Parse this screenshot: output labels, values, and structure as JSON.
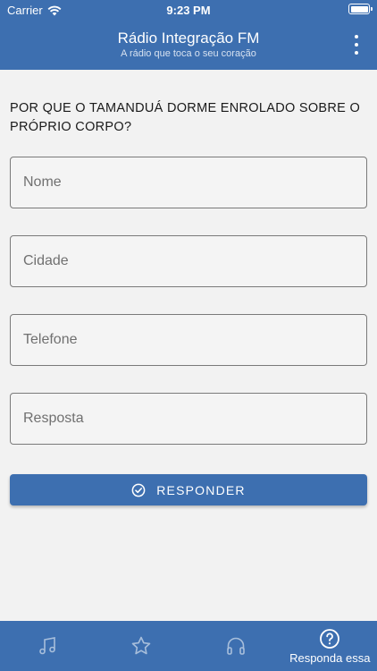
{
  "status_bar": {
    "carrier": "Carrier",
    "time": "9:23 PM"
  },
  "app_bar": {
    "title": "Rádio Integração FM",
    "subtitle": "A rádio que toca o seu coração"
  },
  "question": "POR QUE O TAMANDUÁ DORME ENROLADO SOBRE O PRÓPRIO CORPO?",
  "form": {
    "name_placeholder": "Nome",
    "city_placeholder": "Cidade",
    "phone_placeholder": "Telefone",
    "answer_placeholder": "Resposta",
    "submit_label": "RESPONDER"
  },
  "tabs": [
    {
      "icon": "music-note-icon",
      "label": ""
    },
    {
      "icon": "star-icon",
      "label": ""
    },
    {
      "icon": "headphones-icon",
      "label": ""
    },
    {
      "icon": "question-circle-icon",
      "label": "Responda essa"
    }
  ],
  "colors": {
    "primary": "#3d6fb0",
    "background": "#f2f2f2"
  }
}
